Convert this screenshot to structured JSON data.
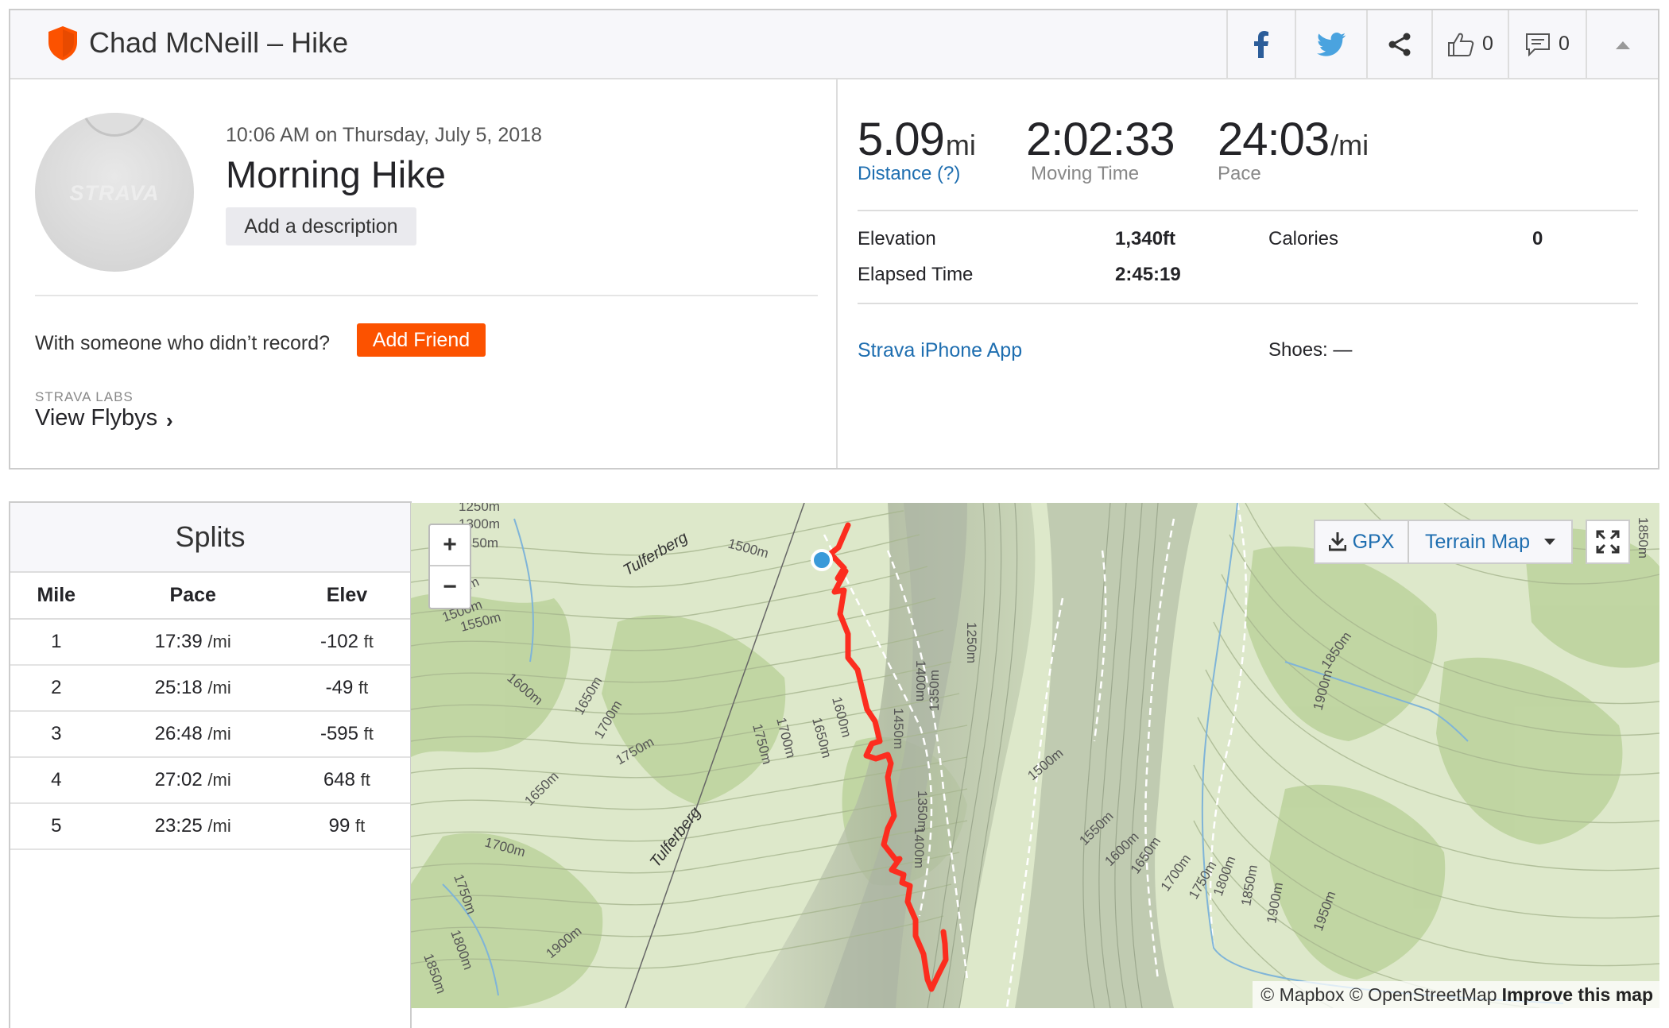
{
  "header": {
    "title": "Chad McNeill – Hike",
    "kudos_count": "0",
    "comments_count": "0"
  },
  "activity": {
    "avatar_text": "STRAVA",
    "date_line": "10:06 AM on Thursday, July 5, 2018",
    "name": "Morning Hike",
    "add_description_label": "Add a description",
    "with_someone_text": "With someone who didn’t record?",
    "add_friend_label": "Add Friend",
    "labs_label": "STRAVA LABS",
    "flybys_label": "View Flybys",
    "flybys_chevron": "›"
  },
  "stats": {
    "distance_value": "5.09",
    "distance_unit": "mi",
    "distance_label": "Distance (?)",
    "moving_time_value": "2:02:33",
    "moving_time_label": "Moving Time",
    "pace_value": "24:03",
    "pace_unit": "/mi",
    "pace_label": "Pace",
    "elevation_label": "Elevation",
    "elevation_value": "1,340ft",
    "calories_label": "Calories",
    "calories_value": "0",
    "elapsed_label": "Elapsed Time",
    "elapsed_value": "2:45:19",
    "device_link": "Strava iPhone App",
    "shoes_text": "Shoes: —"
  },
  "splits": {
    "title": "Splits",
    "headers": [
      "Mile",
      "Pace",
      "Elev"
    ],
    "rows": [
      {
        "mile": "1",
        "pace": "17:39",
        "pace_unit": "/mi",
        "elev": "-102",
        "elev_unit": "ft"
      },
      {
        "mile": "2",
        "pace": "25:18",
        "pace_unit": "/mi",
        "elev": "-49",
        "elev_unit": "ft"
      },
      {
        "mile": "3",
        "pace": "26:48",
        "pace_unit": "/mi",
        "elev": "-595",
        "elev_unit": "ft"
      },
      {
        "mile": "4",
        "pace": "27:02",
        "pace_unit": "/mi",
        "elev": "648",
        "elev_unit": "ft"
      },
      {
        "mile": "5",
        "pace": "23:25",
        "pace_unit": "/mi",
        "elev": "99",
        "elev_unit": "ft"
      }
    ]
  },
  "map": {
    "zoom_in": "+",
    "zoom_out": "−",
    "gpx_label": "GPX",
    "terrain_label": "Terrain Map",
    "attribution": "© Mapbox © OpenStreetMap",
    "improve_label": "Improve this map",
    "labels": {
      "tulferberg_1": "Tulferberg",
      "tulferberg_2": "Tulferberg",
      "e1250": "1250m",
      "e1300": "1300m",
      "e1350": "1350m",
      "e1400": "1400m",
      "e1450": "1450m",
      "e1500": "1500m",
      "e1550": "1550m",
      "e1600": "1600m",
      "e1650": "1650m",
      "e1700": "1700m",
      "e1750": "1750m",
      "e1800": "1800m",
      "e1850": "1850m",
      "e1900": "1900m",
      "e1950": "1950m"
    },
    "colors": {
      "route": "#fc2d1f",
      "start_marker": "#3a9ad9",
      "forest": "#b9cf98",
      "meadow": "#e4ecd4"
    }
  },
  "colors": {
    "brand_orange": "#fc5200",
    "link_blue": "#1e6eb0"
  }
}
